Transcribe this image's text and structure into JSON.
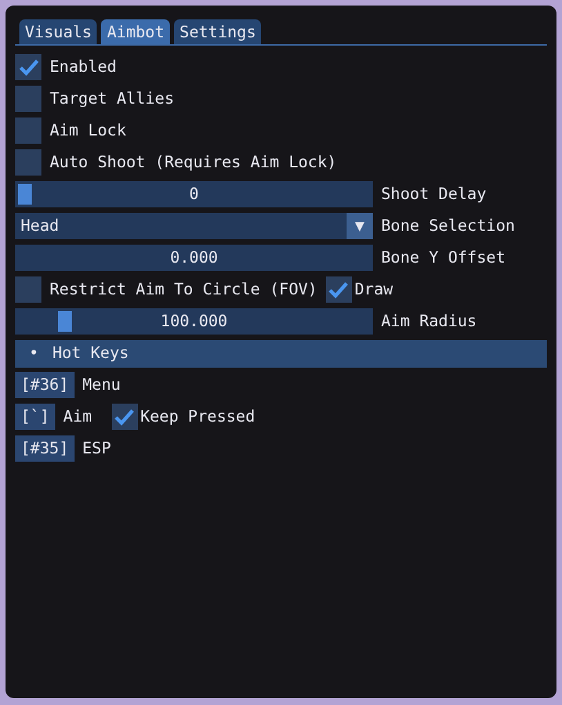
{
  "tabs": [
    {
      "label": "Visuals",
      "selected": false
    },
    {
      "label": "Aimbot",
      "selected": true
    },
    {
      "label": "Settings",
      "selected": false
    }
  ],
  "rows": [
    {
      "kind": "checkbox",
      "label": "Enabled",
      "checked": true
    },
    {
      "kind": "checkbox",
      "label": "Target Allies",
      "checked": false
    },
    {
      "kind": "checkbox",
      "label": "Aim Lock",
      "checked": false
    },
    {
      "kind": "checkbox",
      "label": "Auto Shoot (Requires Aim Lock)",
      "checked": false
    },
    {
      "kind": "slider",
      "label": "Shoot Delay",
      "control": {
        "reading": "0",
        "level": 0
      }
    },
    {
      "kind": "combo",
      "label": "Bone Selection",
      "control": {
        "reading": "Head",
        "arrow": "▼"
      }
    },
    {
      "kind": "input",
      "label": "Bone Y Offset",
      "control": {
        "reading": "0.000"
      }
    },
    {
      "kind": "checkbox2",
      "label": "Restrict Aim To Circle (FOV)",
      "checked": false,
      "label_2": "Draw",
      "checked_2": true
    },
    {
      "kind": "slider",
      "label": "Aim Radius",
      "control": {
        "reading": "100.000",
        "level": 0.12
      }
    },
    {
      "kind": "header",
      "bullet": "•",
      "label": "Hot Keys",
      "expanded": true
    },
    {
      "kind": "hotkey",
      "key": "[#36]",
      "label": "Menu"
    },
    {
      "kind": "hotkey",
      "key": "[`]",
      "label": "Aim",
      "option": "Keep Pressed",
      "checked": true
    },
    {
      "kind": "hotkey",
      "key": "[#35]",
      "label": "ESP"
    }
  ]
}
